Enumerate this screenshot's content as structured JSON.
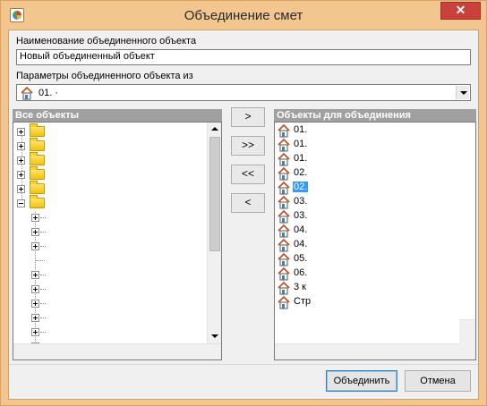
{
  "window": {
    "title": "Объединение смет",
    "close_glyph": "✕"
  },
  "name_field": {
    "label": "Наименование объединенного объекта",
    "value": "Новый объединенный объект"
  },
  "params_field": {
    "label": "Параметры объединенного объекта из",
    "value": "01. ·"
  },
  "left_pane": {
    "header": "Все объекты"
  },
  "right_pane": {
    "header": "Объекты для объединения",
    "items": [
      {
        "label": "01.",
        "selected": false
      },
      {
        "label": "01.",
        "selected": false
      },
      {
        "label": "01.",
        "selected": false
      },
      {
        "label": "02.",
        "selected": false
      },
      {
        "label": "02.",
        "selected": true
      },
      {
        "label": "03.",
        "selected": false
      },
      {
        "label": "03.",
        "selected": false
      },
      {
        "label": "04.",
        "selected": false
      },
      {
        "label": "04.",
        "selected": false
      },
      {
        "label": "05.",
        "selected": false
      },
      {
        "label": "06.",
        "selected": false
      },
      {
        "label": "3 к",
        "selected": false
      },
      {
        "label": "Стр",
        "selected": false
      }
    ]
  },
  "transfer_buttons": {
    "add_one": ">",
    "add_all": ">>",
    "remove_all": "<<",
    "remove_one": "<"
  },
  "footer": {
    "ok_label": "Объединить",
    "cancel_label": "Отмена"
  },
  "colors": {
    "frame": "#f4c68f",
    "close_button": "#c8413a",
    "pane_header": "#a0a0a0",
    "selection": "#3399ff"
  }
}
